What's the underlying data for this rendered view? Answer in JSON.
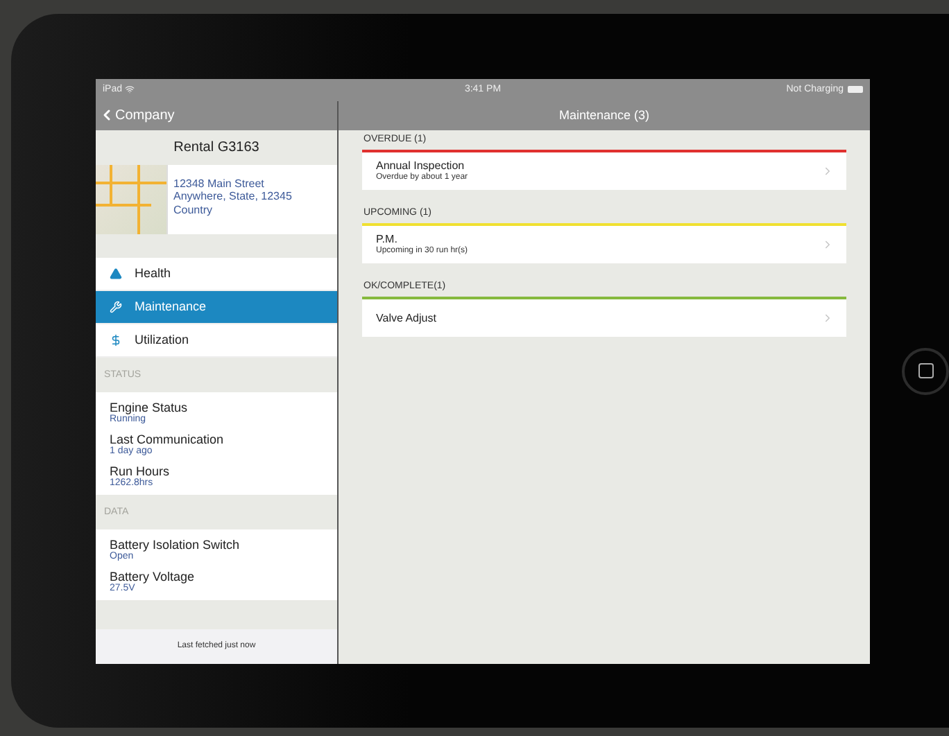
{
  "status_bar": {
    "device": "iPad",
    "time": "3:41 PM",
    "battery": "Not Charging"
  },
  "sidebar": {
    "back": "Company",
    "title": "Rental G3163",
    "address": [
      "12348 Main Street",
      "Anywhere, State, 12345",
      "Country"
    ],
    "nav": [
      {
        "label": "Health",
        "selected": false
      },
      {
        "label": "Maintenance",
        "selected": true
      },
      {
        "label": "Utilization",
        "selected": false
      }
    ],
    "sections": [
      {
        "heading": "STATUS",
        "items": [
          {
            "label": "Engine Status",
            "value": "Running"
          },
          {
            "label": "Last Communication",
            "value": "1 day ago"
          },
          {
            "label": "Run Hours",
            "value": "1262.8hrs"
          }
        ]
      },
      {
        "heading": "DATA",
        "items": [
          {
            "label": "Battery Isolation Switch",
            "value": "Open"
          },
          {
            "label": "Battery Voltage",
            "value": "27.5V"
          }
        ]
      }
    ],
    "footer": "Last fetched just now"
  },
  "main": {
    "title": "Maintenance (3)",
    "groups": [
      {
        "heading": "OVERDUE (1)",
        "color": "#e0312f",
        "items": [
          {
            "title": "Annual Inspection",
            "subtitle": "Overdue by about 1 year"
          }
        ]
      },
      {
        "heading": "UPCOMING (1)",
        "color": "#f0e030",
        "items": [
          {
            "title": "P.M.",
            "subtitle": "Upcoming in 30 run hr(s)"
          }
        ]
      },
      {
        "heading": "OK/COMPLETE(1)",
        "color": "#86b93e",
        "items": [
          {
            "title": "Valve Adjust"
          }
        ]
      }
    ]
  }
}
